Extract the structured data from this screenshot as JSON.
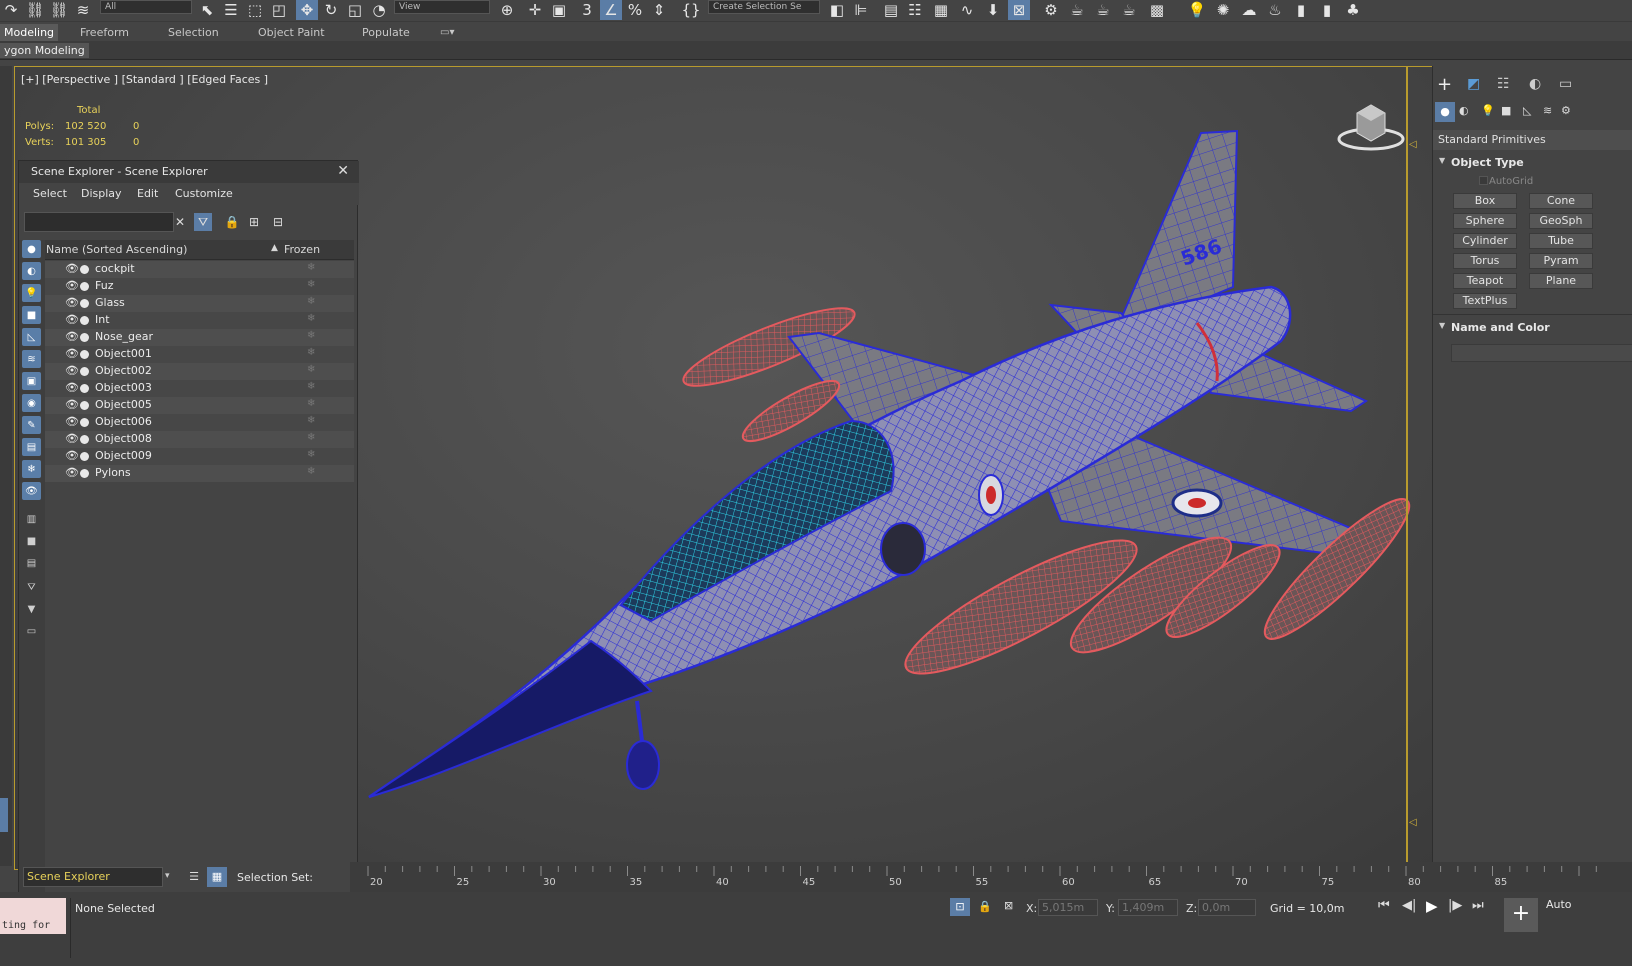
{
  "toolbar": {
    "selection_filter": "All",
    "reference_coord": "View",
    "selection_set_placeholder": "Create Selection Se"
  },
  "ribbon": {
    "tabs": [
      "Modeling",
      "Freeform",
      "Selection",
      "Object Paint",
      "Populate"
    ],
    "active_tab": "Modeling",
    "subtitle": "ygon Modeling"
  },
  "viewport": {
    "label": "[+] [Perspective ] [Standard ] [Edged Faces ]",
    "stats": {
      "header": "Total",
      "polys_label": "Polys:",
      "polys_value": "102 520",
      "polys_sel": "0",
      "verts_label": "Verts:",
      "verts_value": "101 305",
      "verts_sel": "0"
    },
    "aircraft_number": "586"
  },
  "scene_explorer": {
    "title": "Scene Explorer - Scene Explorer",
    "menu": [
      "Select",
      "Display",
      "Edit",
      "Customize"
    ],
    "col_name": "Name (Sorted Ascending)",
    "col_frozen": "Frozen",
    "objects": [
      "cockpit",
      "Fuz",
      "Glass",
      "Int",
      "Nose_gear",
      "Object001",
      "Object002",
      "Object003",
      "Object005",
      "Object006",
      "Object008",
      "Object009",
      "Pylons"
    ],
    "bottom_dropdown": "Scene Explorer",
    "selection_set_label": "Selection Set:"
  },
  "command_panel": {
    "category": "Standard Primitives",
    "object_type_title": "Object Type",
    "autogrid": "AutoGrid",
    "buttons": [
      "Box",
      "Cone",
      "Sphere",
      "GeoSph",
      "Cylinder",
      "Tube",
      "Torus",
      "Pyram",
      "Teapot",
      "Plane",
      "TextPlus"
    ],
    "name_color_title": "Name and Color"
  },
  "timeline": {
    "ticks": [
      "20",
      "25",
      "30",
      "35",
      "40",
      "45",
      "50",
      "55",
      "60",
      "65",
      "70",
      "75",
      "80",
      "85"
    ]
  },
  "status": {
    "selection": "None Selected",
    "script_prompt": "ting for",
    "x_label": "X:",
    "x_value": "5,015m",
    "y_label": "Y:",
    "y_value": "1,409m",
    "z_label": "Z:",
    "z_value": "0,0m",
    "grid": "Grid = 10,0m",
    "auto_key": "Auto"
  },
  "colors": {
    "accent": "#5b7da6",
    "viewport_border": "#b89b2e",
    "stats": "#e8d25a",
    "wire_blue": "#2a2bd6",
    "wire_red": "#e0555a"
  }
}
